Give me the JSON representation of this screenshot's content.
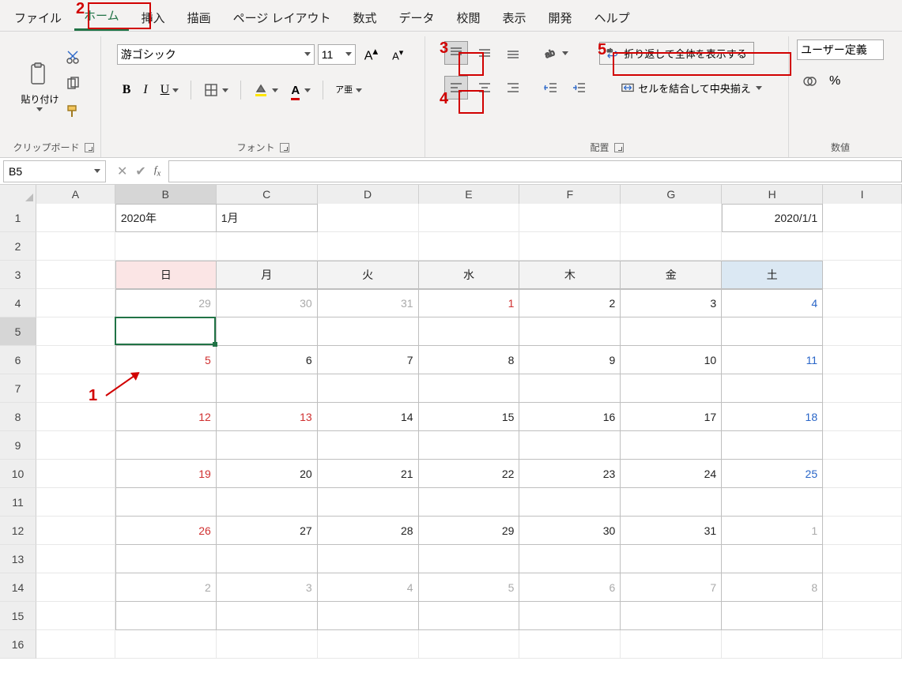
{
  "menu": {
    "items": [
      "ファイル",
      "ホーム",
      "挿入",
      "描画",
      "ページ レイアウト",
      "数式",
      "データ",
      "校閲",
      "表示",
      "開発",
      "ヘルプ"
    ],
    "activeIndex": 1
  },
  "ribbon": {
    "clipboard": {
      "title": "クリップボード",
      "paste_label": "貼り付け"
    },
    "font": {
      "title": "フォント",
      "name": "游ゴシック",
      "size": "11",
      "vertical_text_label": "ア亜"
    },
    "alignment": {
      "title": "配置",
      "wrap_label": "折り返して全体を表示する",
      "merge_label": "セルを結合して中央揃え"
    },
    "number": {
      "title": "数値",
      "format_label": "ユーザー定義"
    }
  },
  "namebox": "B5",
  "col_headers": [
    "A",
    "B",
    "C",
    "D",
    "E",
    "F",
    "G",
    "H",
    "I"
  ],
  "selected_col_index": 1,
  "row_headers": [
    "1",
    "2",
    "3",
    "4",
    "5",
    "6",
    "7",
    "8",
    "9",
    "10",
    "11",
    "12",
    "13",
    "14",
    "15",
    "16"
  ],
  "selected_row_index": 4,
  "cells": {
    "B1": "2020年",
    "C1": "1月",
    "H1": "2020/1/1"
  },
  "calendar": {
    "day_headers": [
      "日",
      "月",
      "火",
      "水",
      "木",
      "金",
      "土"
    ],
    "weeks": [
      [
        {
          "n": "29",
          "cls": "txt-grey"
        },
        {
          "n": "30",
          "cls": "txt-grey"
        },
        {
          "n": "31",
          "cls": "txt-grey"
        },
        {
          "n": "1",
          "cls": "txt-red"
        },
        {
          "n": "2",
          "cls": ""
        },
        {
          "n": "3",
          "cls": ""
        },
        {
          "n": "4",
          "cls": "txt-blue"
        }
      ],
      [
        {
          "n": "5",
          "cls": "txt-red"
        },
        {
          "n": "6",
          "cls": ""
        },
        {
          "n": "7",
          "cls": ""
        },
        {
          "n": "8",
          "cls": ""
        },
        {
          "n": "9",
          "cls": ""
        },
        {
          "n": "10",
          "cls": ""
        },
        {
          "n": "11",
          "cls": "txt-blue"
        }
      ],
      [
        {
          "n": "12",
          "cls": "txt-red"
        },
        {
          "n": "13",
          "cls": "txt-red"
        },
        {
          "n": "14",
          "cls": ""
        },
        {
          "n": "15",
          "cls": ""
        },
        {
          "n": "16",
          "cls": ""
        },
        {
          "n": "17",
          "cls": ""
        },
        {
          "n": "18",
          "cls": "txt-blue"
        }
      ],
      [
        {
          "n": "19",
          "cls": "txt-red"
        },
        {
          "n": "20",
          "cls": ""
        },
        {
          "n": "21",
          "cls": ""
        },
        {
          "n": "22",
          "cls": ""
        },
        {
          "n": "23",
          "cls": ""
        },
        {
          "n": "24",
          "cls": ""
        },
        {
          "n": "25",
          "cls": "txt-blue"
        }
      ],
      [
        {
          "n": "26",
          "cls": "txt-red"
        },
        {
          "n": "27",
          "cls": ""
        },
        {
          "n": "28",
          "cls": ""
        },
        {
          "n": "29",
          "cls": ""
        },
        {
          "n": "30",
          "cls": ""
        },
        {
          "n": "31",
          "cls": ""
        },
        {
          "n": "1",
          "cls": "txt-grey"
        }
      ],
      [
        {
          "n": "2",
          "cls": "txt-grey"
        },
        {
          "n": "3",
          "cls": "txt-grey"
        },
        {
          "n": "4",
          "cls": "txt-grey"
        },
        {
          "n": "5",
          "cls": "txt-grey"
        },
        {
          "n": "6",
          "cls": "txt-grey"
        },
        {
          "n": "7",
          "cls": "txt-grey"
        },
        {
          "n": "8",
          "cls": "txt-grey"
        }
      ]
    ]
  },
  "annotations": {
    "n1": "1",
    "n2": "2",
    "n3": "3",
    "n4": "4",
    "n5": "5"
  }
}
